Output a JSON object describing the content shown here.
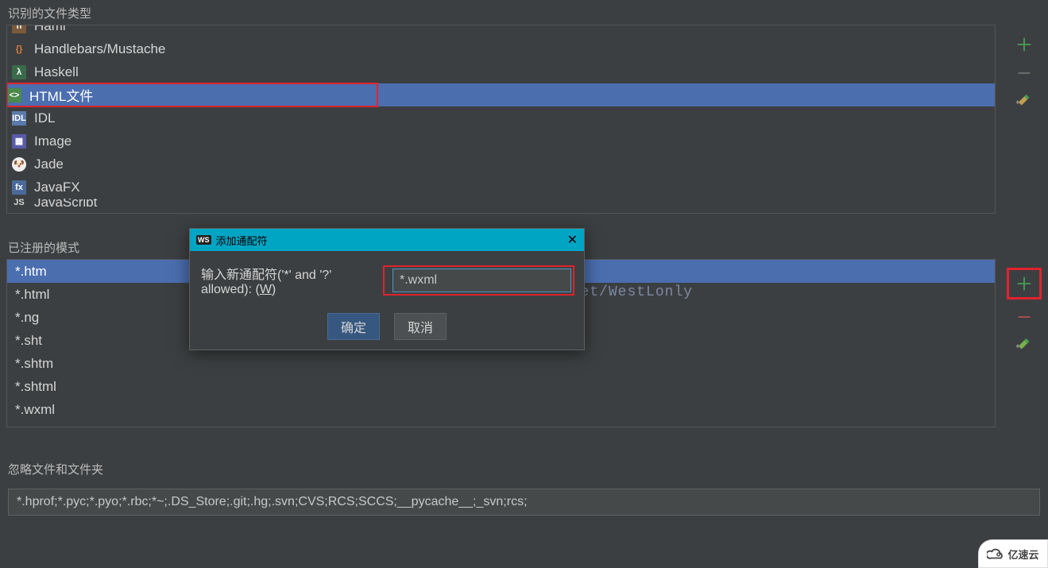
{
  "sections": {
    "file_types_label": "识别的文件类型",
    "patterns_label": "已注册的模式",
    "ignore_label": "忽略文件和文件夹"
  },
  "file_types": {
    "items": [
      {
        "label": "Haml",
        "icon": "h",
        "cut": "top"
      },
      {
        "label": "Handlebars/Mustache",
        "icon": "hb"
      },
      {
        "label": "Haskell",
        "icon": "hs"
      },
      {
        "label": "HTML文件",
        "icon": "html",
        "selected": true,
        "red": true
      },
      {
        "label": "IDL",
        "icon": "idl"
      },
      {
        "label": "Image",
        "icon": "img"
      },
      {
        "label": "Jade",
        "icon": "jade"
      },
      {
        "label": "JavaFX",
        "icon": "jfx"
      },
      {
        "label": "JavaScript",
        "icon": "js",
        "cut": "bottom"
      }
    ]
  },
  "patterns": {
    "items": [
      {
        "label": "*.htm",
        "selected": true
      },
      {
        "label": "*.html"
      },
      {
        "label": "*.ng"
      },
      {
        "label": "*.sht"
      },
      {
        "label": "*.shtm"
      },
      {
        "label": "*.shtml"
      },
      {
        "label": "*.wxml"
      }
    ]
  },
  "ignore": {
    "value": "*.hprof;*.pyc;*.pyo;*.rbc;*~;.DS_Store;.git;.hg;.svn;CVS;RCS;SCCS;__pycache__;_svn;rcs;"
  },
  "dialog": {
    "title": "添加通配符",
    "label_prefix": "输入新通配符('*' and '?' allowed): (",
    "label_key": "W",
    "label_suffix": ")",
    "input_value": "*.wxml",
    "ok": "确定",
    "cancel": "取消"
  },
  "watermark": "http://blog.csdn.net/WestLonly",
  "badge": "亿速云"
}
